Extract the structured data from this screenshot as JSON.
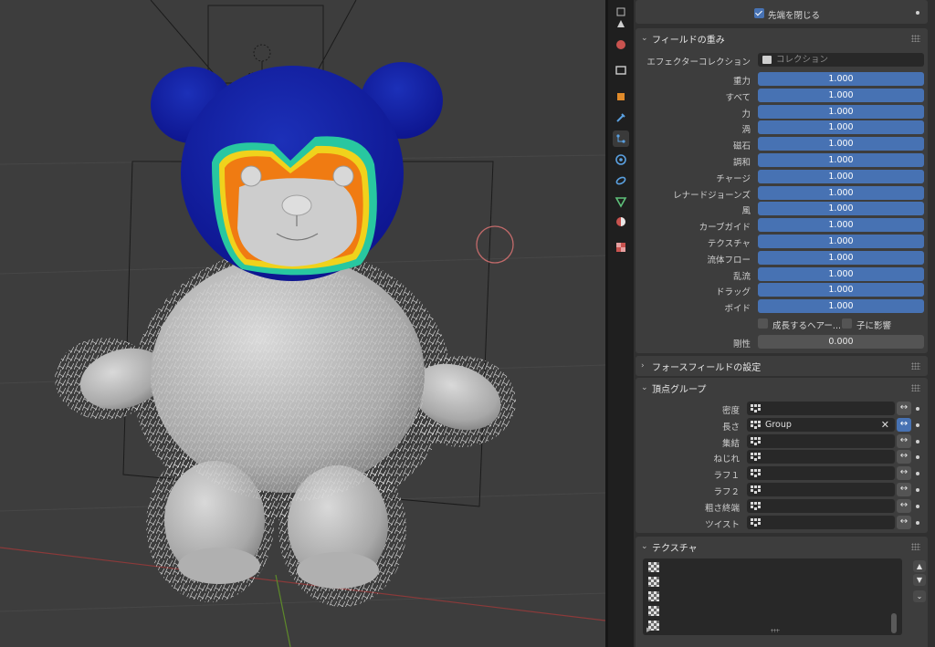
{
  "hair_dynamics": {
    "close_tip_label": "先端を閉じる",
    "close_tip_checked": true
  },
  "field_weights": {
    "title": "フィールドの重み",
    "effector_collection_label": "エフェクターコレクション",
    "effector_collection_placeholder": "コレクション",
    "weights": [
      {
        "label": "重力",
        "value": "1.000"
      },
      {
        "label": "すべて",
        "value": "1.000"
      },
      {
        "label": "力",
        "value": "1.000"
      },
      {
        "label": "渦",
        "value": "1.000"
      },
      {
        "label": "磁石",
        "value": "1.000"
      },
      {
        "label": "調和",
        "value": "1.000"
      },
      {
        "label": "チャージ",
        "value": "1.000"
      },
      {
        "label": "レナードジョーンズ",
        "value": "1.000"
      },
      {
        "label": "風",
        "value": "1.000"
      },
      {
        "label": "カーブガイド",
        "value": "1.000"
      },
      {
        "label": "テクスチャ",
        "value": "1.000"
      },
      {
        "label": "流体フロー",
        "value": "1.000"
      },
      {
        "label": "乱流",
        "value": "1.000"
      },
      {
        "label": "ドラッグ",
        "value": "1.000"
      },
      {
        "label": "ボイド",
        "value": "1.000"
      }
    ],
    "grow_hair_label": "成長するヘアー...",
    "affect_children_label": "子に影響",
    "stiffness_label": "剛性",
    "stiffness_value": "0.000"
  },
  "force_field_settings": {
    "title": "フォースフィールドの設定"
  },
  "vertex_groups": {
    "title": "頂点グループ",
    "rows": [
      {
        "label": "密度",
        "value": "",
        "inverted": false
      },
      {
        "label": "長さ",
        "value": "Group",
        "inverted": true
      },
      {
        "label": "集結",
        "value": "",
        "inverted": false
      },
      {
        "label": "ねじれ",
        "value": "",
        "inverted": false
      },
      {
        "label": "ラフ１",
        "value": "",
        "inverted": false
      },
      {
        "label": "ラフ２",
        "value": "",
        "inverted": false
      },
      {
        "label": "粗さ終端",
        "value": "",
        "inverted": false
      },
      {
        "label": "ツイスト",
        "value": "",
        "inverted": false
      }
    ],
    "invert_symbol": "↔",
    "clear_symbol": "✕"
  },
  "texture": {
    "title": "テクスチャ",
    "slot_count": 5
  },
  "tabs": [
    "tool",
    "render",
    "output",
    "view-layer",
    "scene",
    "world",
    "collection",
    "object",
    "modifiers",
    "particles",
    "physics",
    "constraints",
    "data",
    "material",
    "texture"
  ],
  "colors": {
    "accent": "#4772b3",
    "panel": "#3d3d3d",
    "viewport": "#3d3d3d"
  }
}
